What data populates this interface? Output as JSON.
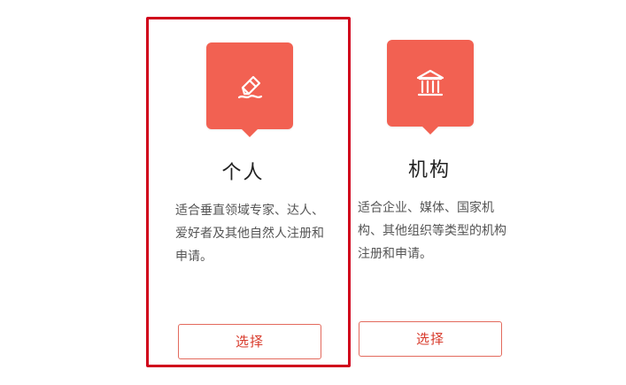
{
  "colors": {
    "accent": "#f26152",
    "selected_border": "#d0021b",
    "button_text": "#d83b2c",
    "button_border": "#e36a5d",
    "title_text": "#222222",
    "desc_text": "#555555"
  },
  "cards": [
    {
      "id": "personal",
      "selected": true,
      "icon": "pencil-signature-icon",
      "title": "个人",
      "description": "适合垂直领域专家、达人、爱好者及其他自然人注册和申请。",
      "button_label": "选择"
    },
    {
      "id": "organization",
      "selected": false,
      "icon": "institution-building-icon",
      "title": "机构",
      "description": "适合企业、媒体、国家机构、其他组织等类型的机构注册和申请。",
      "button_label": "选择"
    }
  ]
}
